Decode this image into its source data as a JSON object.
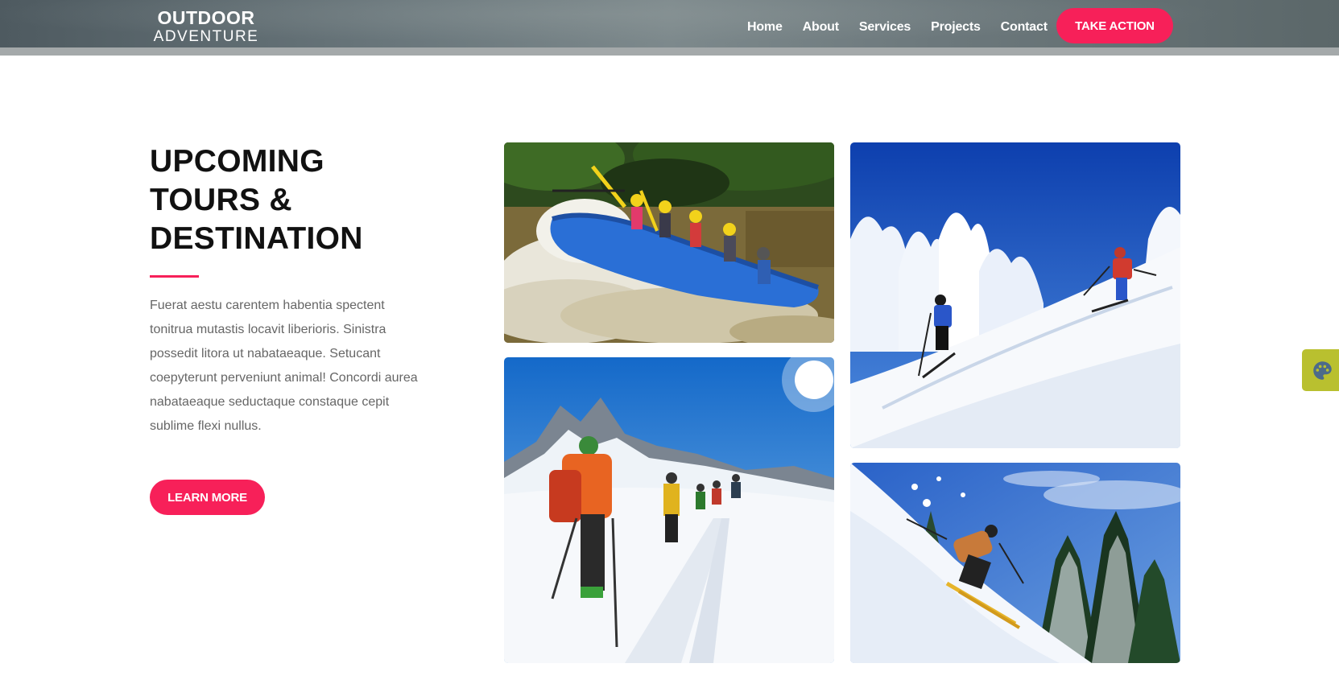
{
  "brand": {
    "name_top": "OUTDOOR",
    "name_bottom": "ADVENTURE"
  },
  "nav": {
    "items": [
      {
        "label": "Home"
      },
      {
        "label": "About"
      },
      {
        "label": "Services"
      },
      {
        "label": "Projects"
      },
      {
        "label": "Contact"
      }
    ],
    "cta_label": "TAKE ACTION"
  },
  "section": {
    "heading_lines": [
      "UPCOMING",
      "TOURS &",
      "DESTINATION"
    ],
    "body": "Fuerat aestu carentem habentia spectent tonitrua mutastis locavit liberioris. Sinistra possedit litora ut nabataeaque. Setucant coepyterunt perveniunt animal! Concordi aurea nabataeaque seductaque constaque cepit sublime flexi nullus.",
    "button_label": "LEARN MORE"
  },
  "gallery": {
    "images": [
      {
        "subject": "white-water-rafting"
      },
      {
        "subject": "mountain-ski-trekking"
      },
      {
        "subject": "skiers-snowy-slope"
      },
      {
        "subject": "skier-powder-jump"
      }
    ]
  },
  "widgets": {
    "palette_icon": "palette-icon"
  },
  "colors": {
    "accent": "#f72059",
    "header_bg": "#6a777c",
    "heading": "#111111",
    "body_text": "#666666",
    "palette_tab": "#b9c02f"
  }
}
